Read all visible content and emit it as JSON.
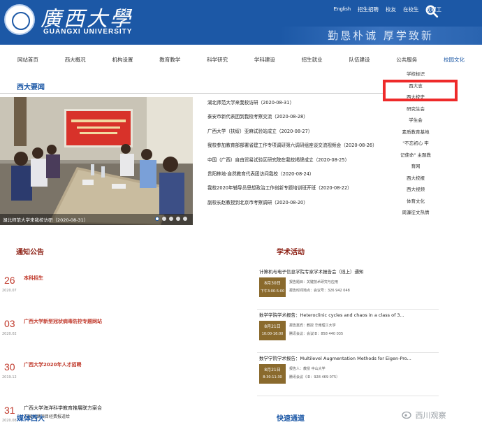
{
  "header": {
    "title_cn": "廣西大學",
    "title_en": "GUANGXI UNIVERSITY",
    "links": [
      "English",
      "招生招聘",
      "校友",
      "在校生",
      "教职工"
    ],
    "slogan": "勤恳朴诚 厚学致新"
  },
  "nav": {
    "items": [
      "网站首页",
      "西大概况",
      "机构设置",
      "教育教学",
      "科学研究",
      "学科建设",
      "招生就业",
      "队伍建设",
      "公共服务",
      "校园文化"
    ],
    "active": "校园文化",
    "dropdown": [
      "学校标识",
      "西大志",
      "西大校史",
      "研究生会",
      "学生会",
      "素质教育基地",
      "\"不忘初心 牢",
      "记使命\" 主题教",
      "育网",
      "西大校报",
      "西大视频",
      "体育文化",
      "周濂征文热情"
    ]
  },
  "news": {
    "section_title": "西大要闻",
    "photo_caption": "湖北师范大学来我校访研（2020-08-31）",
    "items": [
      "湖北师范大学来我校访研（2020-08-31）",
      "泰安市新代表团到我校考察交流（2020-08-28）",
      "广西大学（扶绥）亚麻试验站成立（2020-08-27）",
      "我校参加教育部部署省建工作专项调研第六调研组座谈交流视频会（2020-08-26）",
      "中国（广西）自由贸易试验区研究院在我校揭牌成立（2020-08-25）",
      "贵阳林地·自然教育代表团访问我校（2020-08-24）",
      "我校2020年辅导员思想政治工作创新专题培训班开班（2020-08-22）",
      "副校长赵教授到北京市考察调研（2020-08-20）"
    ]
  },
  "notices": {
    "section_title": "通知公告",
    "items": [
      {
        "day": "26",
        "month": "2020.07",
        "text": "本科招生",
        "sub": ""
      },
      {
        "day": "03",
        "month": "2020.02",
        "text": "广西大学新型冠状病毒防控专题网站",
        "sub": ""
      },
      {
        "day": "30",
        "month": "2019.12",
        "text": "广西大学2020年人才招聘",
        "sub": ""
      },
      {
        "day": "31",
        "month": "2020.08",
        "text": "广西大学海洋科学教育推展联方案合",
        "sub": "开展关键项目经费报道给"
      }
    ]
  },
  "academic": {
    "section_title": "学术活动",
    "items": [
      {
        "title": "计算机与电子信息学院专家学术报告会（线上）通知",
        "date": "8月30日",
        "time": "下午3:00-5:00",
        "lines": [
          "报告题目：关键技术研究与应用",
          "报告时间地点：会议号：326 942 048"
        ]
      },
      {
        "title": "数学学院学术报告：Heteroclinic cycles and chaos in a class of 3...",
        "date": "8月21日",
        "time": "10:00-16:00",
        "lines": [
          "报告嘉宾：教授 华南理工大学",
          "腾讯会议：会议ID：858 440 035"
        ]
      },
      {
        "title": "数学学院学术报告：Multilevel Augmentation Methods for Eigen-Pro...",
        "date": "8月21日",
        "time": "8:30-11:30",
        "lines": [
          "报告人：教授 中山大学",
          "腾讯会议（ID：928 469 075）"
        ]
      }
    ]
  },
  "bottom": {
    "media_title": "媒体西大",
    "quick_title": "快速通道",
    "watermark": "西川观察"
  },
  "colors": {
    "brand_blue": "#1c58a6",
    "notice_red": "#c0392b",
    "highlight": "#ee2a2a",
    "date_badge": "#8a6a2d"
  }
}
